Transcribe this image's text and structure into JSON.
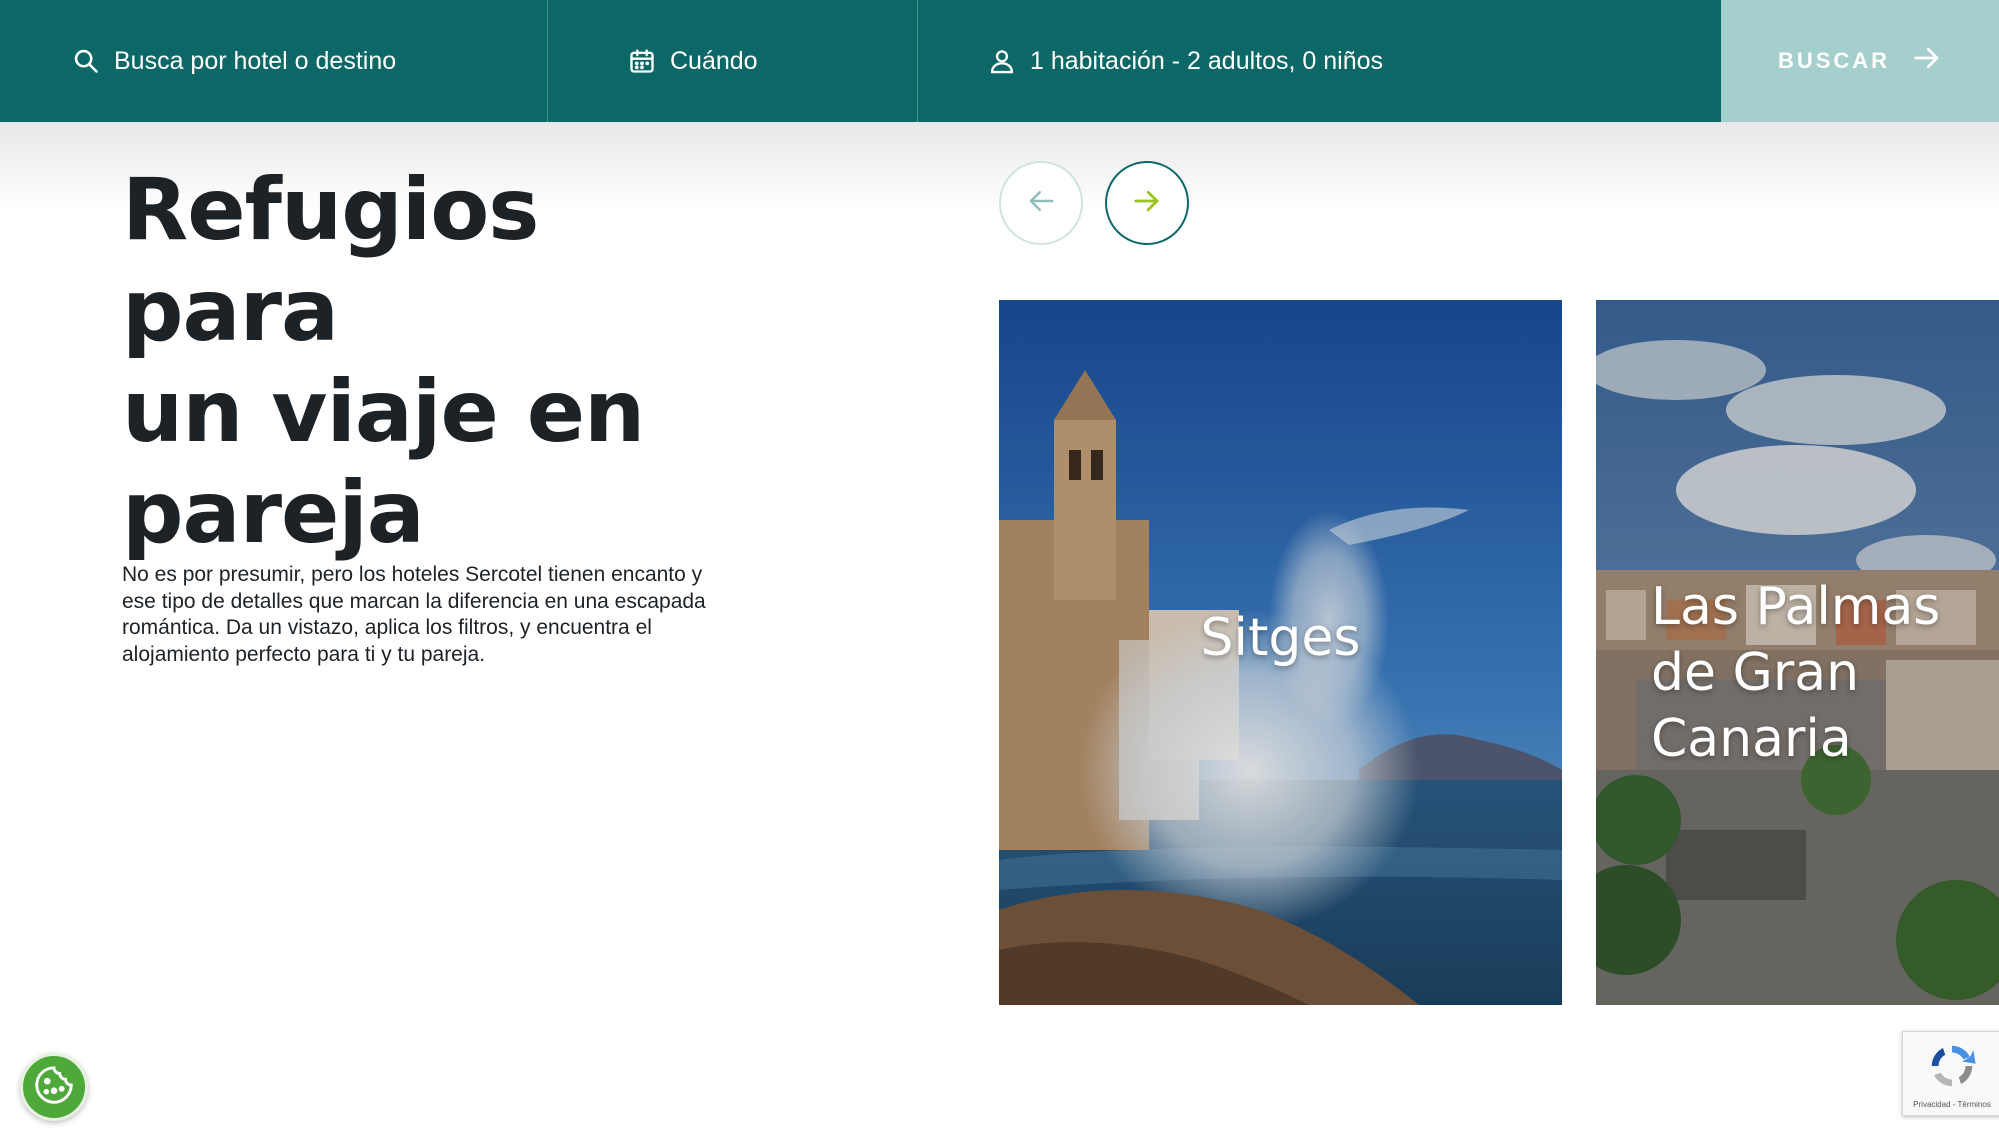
{
  "search_bar": {
    "destination_placeholder": "Busca por hotel o destino",
    "destination_icon": "search-icon",
    "dates_label": "Cuándo",
    "dates_icon": "calendar-icon",
    "guests_label": "1 habitación - 2 adultos, 0 niños",
    "guests_icon": "person-icon",
    "submit_label": "BUSCAR",
    "submit_icon": "arrow-right-icon"
  },
  "section": {
    "title_lines": [
      "Refugios para",
      "un viaje en",
      "pareja"
    ],
    "description": "No es por presumir, pero los hoteles Sercotel tienen encanto y ese tipo de detalles que marcan la diferencia en una escapada romántica. Da un vistazo, aplica los filtros, y encuentra el alojamiento perfecto para ti y tu pareja."
  },
  "carousel": {
    "prev_icon": "arrow-left-icon",
    "next_icon": "arrow-right-icon",
    "cards": [
      {
        "title": "Sitges"
      },
      {
        "title": "Las Palmas de Gran Canaria"
      }
    ]
  },
  "widgets": {
    "cookie_icon": "cookie-icon",
    "recaptcha_text": "Privacidad - Términos"
  },
  "colors": {
    "brand_teal": "#0b6866",
    "button_light_teal": "#a5cfcc",
    "accent_lime": "#9bc21c",
    "cookie_green": "#4ea83a"
  }
}
